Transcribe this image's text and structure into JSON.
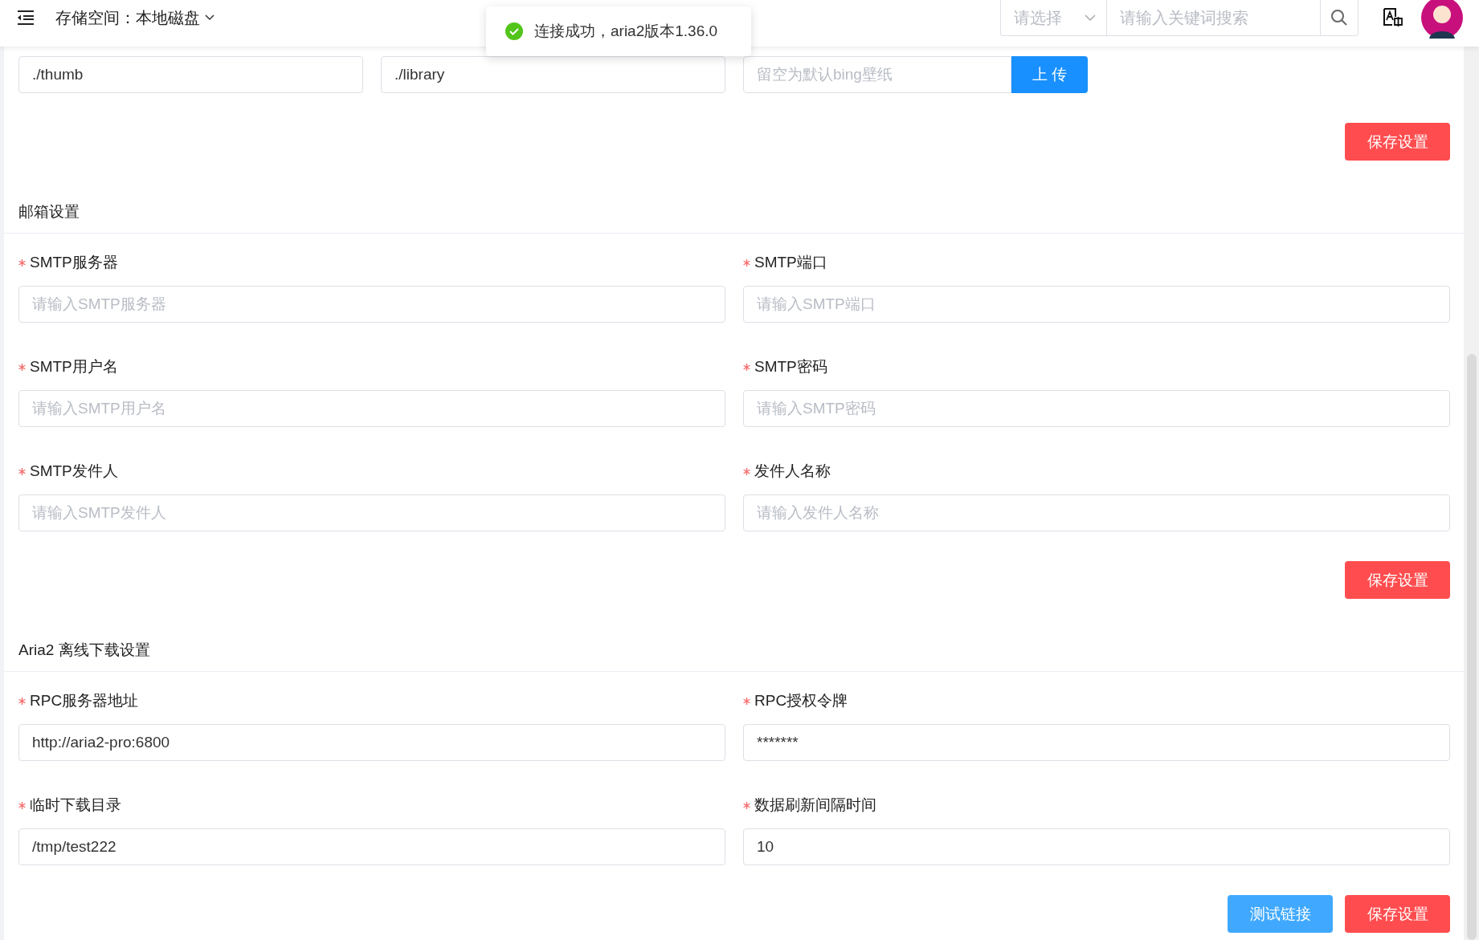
{
  "header": {
    "storage": "存储空间：本地磁盘",
    "filter": {
      "placeholder": "请选择"
    },
    "search": {
      "placeholder": "请输入关键词搜索"
    }
  },
  "toast": {
    "kind": "success",
    "message": "连接成功，aria2版本1.36.0"
  },
  "sections": [
    {
      "fields": [
        {
          "kind": "input",
          "value": "./thumb"
        },
        {
          "kind": "input",
          "value": "./library"
        },
        {
          "kind": "upload",
          "placeholder": "留空为默认bing壁纸",
          "button": "上 传"
        }
      ],
      "buttons": [
        {
          "kind": "danger",
          "label": "保存设置"
        }
      ]
    },
    {
      "title": "邮箱设置",
      "fields": [
        {
          "kind": "input",
          "label": "SMTP服务器",
          "required": true,
          "placeholder": "请输入SMTP服务器"
        },
        {
          "kind": "input",
          "label": "SMTP端口",
          "required": true,
          "placeholder": "请输入SMTP端口"
        },
        {
          "kind": "input",
          "label": "SMTP用户名",
          "required": true,
          "placeholder": "请输入SMTP用户名"
        },
        {
          "kind": "input",
          "label": "SMTP密码",
          "required": true,
          "placeholder": "请输入SMTP密码"
        },
        {
          "kind": "input",
          "label": "SMTP发件人",
          "required": true,
          "placeholder": "请输入SMTP发件人"
        },
        {
          "kind": "input",
          "label": "发件人名称",
          "required": true,
          "placeholder": "请输入发件人名称"
        }
      ],
      "buttons": [
        {
          "kind": "danger",
          "label": "保存设置"
        }
      ]
    },
    {
      "title": "Aria2 离线下载设置",
      "fields": [
        {
          "kind": "input",
          "label": "RPC服务器地址",
          "required": true,
          "value": "http://aria2-pro:6800"
        },
        {
          "kind": "input",
          "label": "RPC授权令牌",
          "required": true,
          "value": "*******"
        },
        {
          "kind": "input",
          "label": "临时下载目录",
          "required": true,
          "value": "/tmp/test222"
        },
        {
          "kind": "input",
          "label": "数据刷新间隔时间",
          "required": true,
          "value": "10"
        }
      ],
      "buttons": [
        {
          "kind": "primary",
          "label": "测试链接"
        },
        {
          "kind": "danger",
          "label": "保存设置"
        }
      ]
    }
  ]
}
